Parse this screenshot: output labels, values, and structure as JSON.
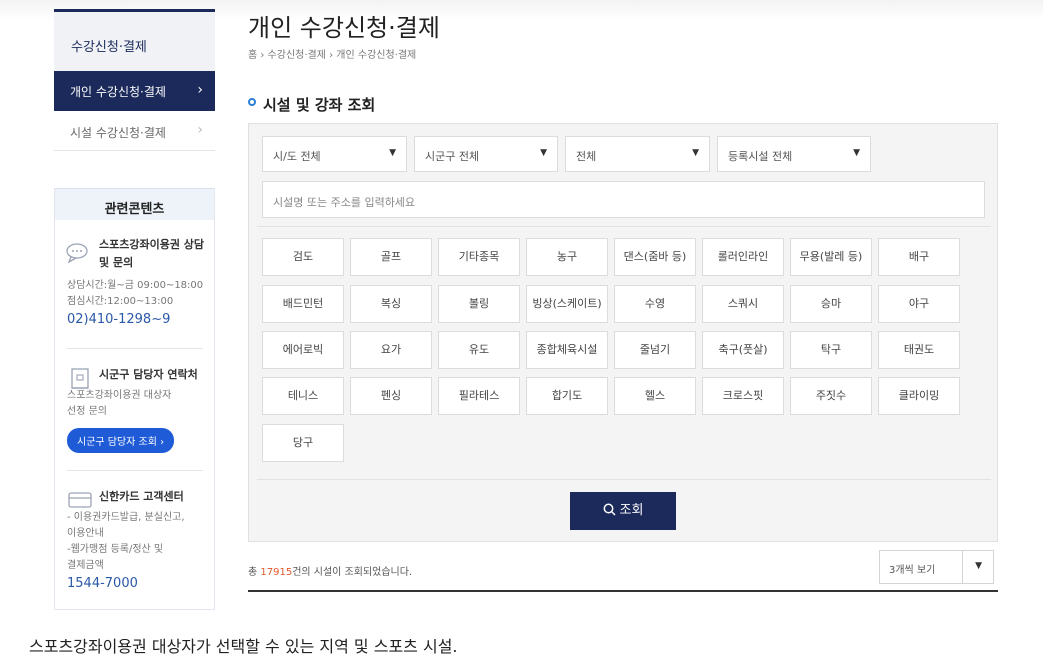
{
  "sidebar": {
    "header": "수강신청·결제",
    "items": [
      {
        "label": "개인 수강신청·결제",
        "active": true
      },
      {
        "label": "시설 수강신청·결제",
        "active": false
      }
    ],
    "chevron": "›"
  },
  "related": {
    "title": "관련콘텐츠",
    "blocks": [
      {
        "icon": "chat-icon",
        "title": "스포츠강좌이용권 상담 및 문의",
        "lines": [
          "상담시간:월~금 09:00~18:00",
          "점심시간:12:00~13:00"
        ],
        "phone": "02)410-1298~9"
      },
      {
        "icon": "building-icon",
        "title": "시군구 담당자 연락처",
        "lines": [
          "스포츠강좌이용권 대상자",
          "선정 문의"
        ],
        "button": "시군구 담당자 조회 ›"
      },
      {
        "icon": "card-icon",
        "title": "신한카드 고객센터",
        "lines": [
          "- 이용권카드발급, 분실신고,",
          "이용안내",
          "-웹가맹점 등록/정산 및",
          "결제금액"
        ],
        "phone": "1544-7000"
      }
    ]
  },
  "page": {
    "title": "개인 수강신청·결제",
    "breadcrumb": "홈 › 수강신청·결제 › 개인 수강신청·결제",
    "section_title": "시설 및 강좌 조회"
  },
  "filters": {
    "selects": [
      "시/도 전체",
      "시군구 전체",
      "전체",
      "등록시설 전체"
    ],
    "search_placeholder": "시설명 또는 주소를 입력하세요"
  },
  "sports": [
    "검도",
    "골프",
    "기타종목",
    "농구",
    "댄스(줌바 등)",
    "롤러인라인",
    "무용(발레 등)",
    "배구",
    "배드민턴",
    "복싱",
    "볼링",
    "빙상(스케이트)",
    "수영",
    "스쿼시",
    "승마",
    "야구",
    "에어로빅",
    "요가",
    "유도",
    "종합체육시설",
    "줄넘기",
    "축구(풋살)",
    "탁구",
    "태권도",
    "테니스",
    "펜싱",
    "필라테스",
    "합기도",
    "헬스",
    "크로스핏",
    "주짓수",
    "클라이밍",
    "당구"
  ],
  "search_button": "조회",
  "result": {
    "prefix": "총 ",
    "count": "17915",
    "suffix": "건의 시설이 조회되었습니다."
  },
  "view_select": "3개씩 보기",
  "caption": "스포츠강좌이용권 대상자가 선택할 수 있는 지역 및 스포츠 시설."
}
